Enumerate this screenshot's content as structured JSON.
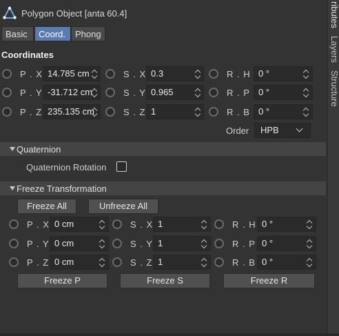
{
  "title": "Polygon Object [anta 60.4]",
  "tabs": [
    {
      "label": "Basic",
      "active": false
    },
    {
      "label": "Coord.",
      "active": true
    },
    {
      "label": "Phong",
      "active": false
    }
  ],
  "coordinates": {
    "heading": "Coordinates",
    "pos": [
      {
        "label": "P . X",
        "value": "14.785 cm"
      },
      {
        "label": "P . Y",
        "value": "-31.712 cm"
      },
      {
        "label": "P . Z",
        "value": "235.135 cm"
      }
    ],
    "scale": [
      {
        "label": "S . X",
        "value": "0.3"
      },
      {
        "label": "S . Y",
        "value": "0.965"
      },
      {
        "label": "S . Z",
        "value": "1"
      }
    ],
    "rot": [
      {
        "label": "R . H",
        "value": "0 °"
      },
      {
        "label": "R . P",
        "value": "0 °"
      },
      {
        "label": "R . B",
        "value": "0 °"
      }
    ],
    "order_label": "Order",
    "order_value": "HPB"
  },
  "quaternion": {
    "heading": "Quaternion",
    "rotation_label": "Quaternion Rotation",
    "rotation_checked": false
  },
  "freeze": {
    "heading": "Freeze Transformation",
    "freeze_all": "Freeze All",
    "unfreeze_all": "Unfreeze All",
    "pos": [
      {
        "label": "P . X",
        "value": "0 cm"
      },
      {
        "label": "P . Y",
        "value": "0 cm"
      },
      {
        "label": "P . Z",
        "value": "0 cm"
      }
    ],
    "scale": [
      {
        "label": "S . X",
        "value": "1"
      },
      {
        "label": "S . Y",
        "value": "1"
      },
      {
        "label": "S . Z",
        "value": "1"
      }
    ],
    "rot": [
      {
        "label": "R . H",
        "value": "0 °"
      },
      {
        "label": "R . P",
        "value": "0 °"
      },
      {
        "label": "R . B",
        "value": "0 °"
      }
    ],
    "freeze_p": "Freeze P",
    "freeze_s": "Freeze S",
    "freeze_r": "Freeze R"
  },
  "side_tabs": [
    "ributes",
    "Layers",
    "Structure"
  ],
  "colors": {
    "accent": "#5b7ab0",
    "panel": "#333333",
    "field": "#2a2a2a"
  }
}
